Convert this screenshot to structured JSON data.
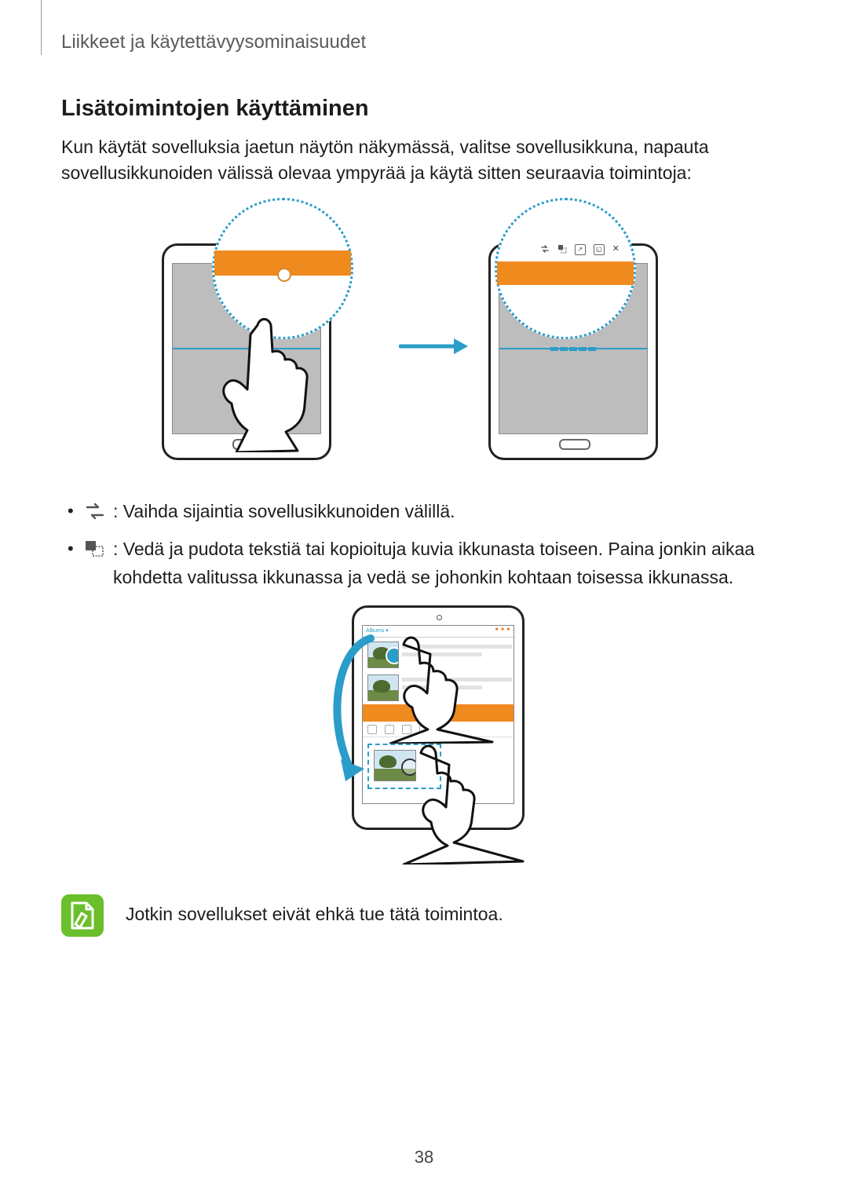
{
  "header": "Liikkeet ja käytettävyysominaisuudet",
  "section_title": "Lisätoimintojen käyttäminen",
  "intro": "Kun käytät sovelluksia jaetun näytön näkymässä, valitse sovellusikkuna, napauta sovellusikkunoiden välissä olevaa ympyrää ja käytä sitten seuraavia toimintoja:",
  "bullets": {
    "swap": ": Vaihda sijaintia sovellusikkunoiden välillä.",
    "drag": ": Vedä ja pudota tekstiä tai kopioituja kuvia ikkunasta toiseen. Paina jonkin aikaa kohdetta valitussa ikkunassa ja vedä se johonkin kohtaan toisessa ikkunassa."
  },
  "note": "Jotkin sovellukset eivät ehkä tue tätä toimintoa.",
  "page_number": "38"
}
